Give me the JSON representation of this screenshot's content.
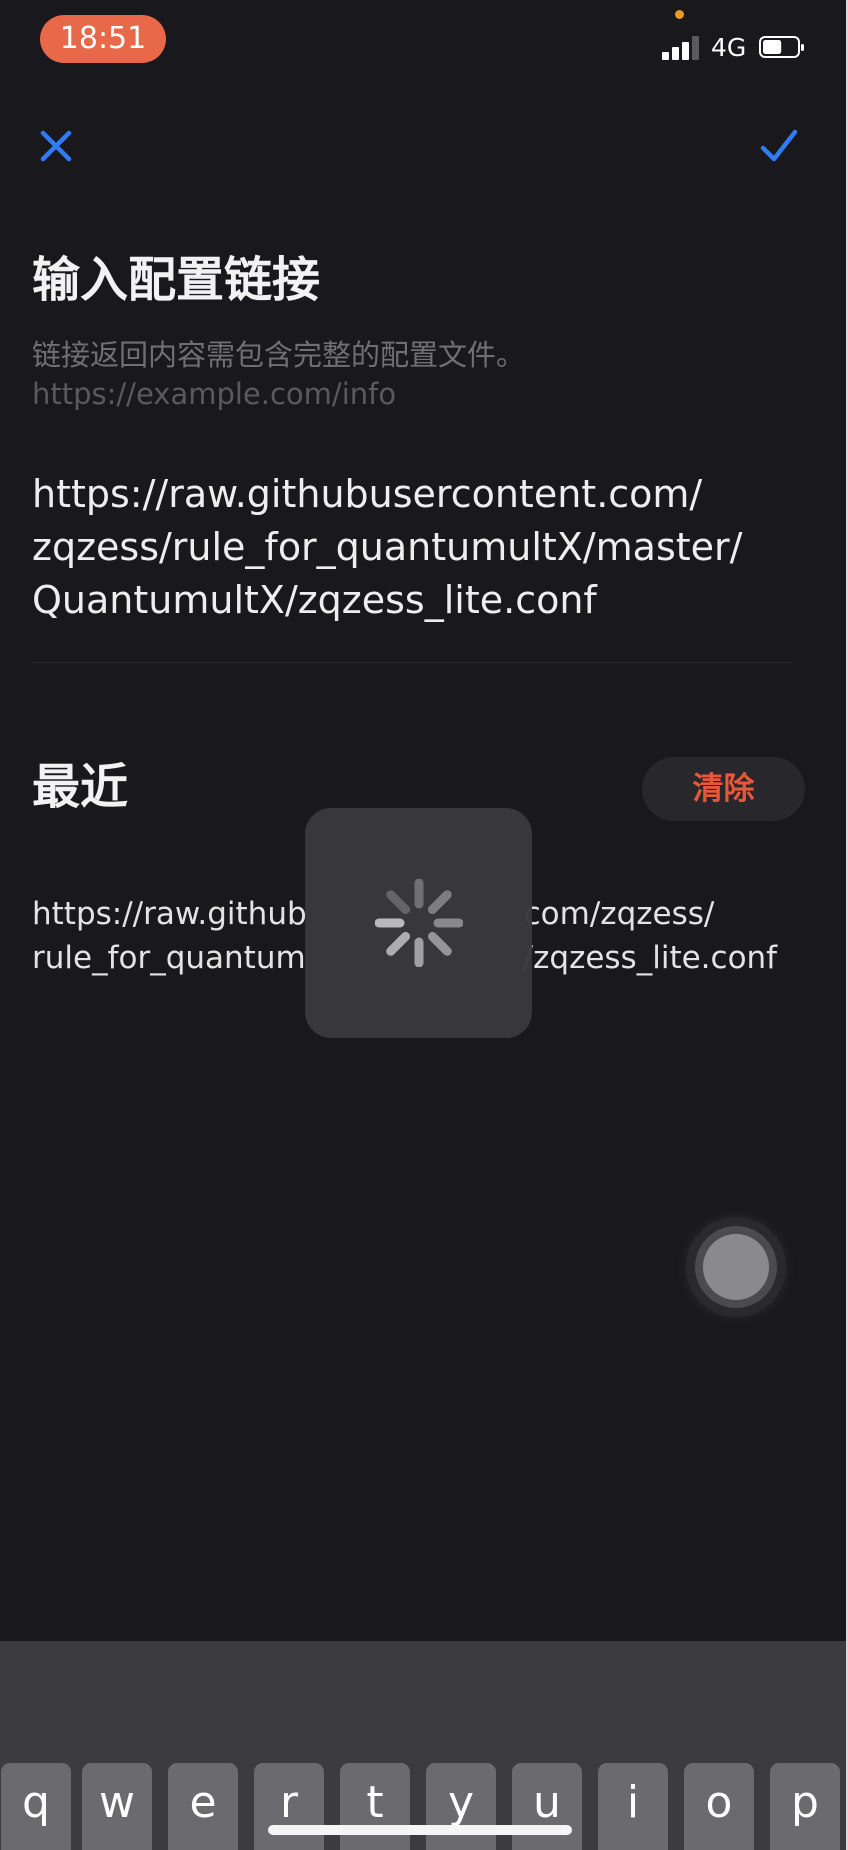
{
  "status_bar": {
    "time": "18:51",
    "network": "4G",
    "time_pill_color": "#e8684a",
    "privacy_dot_color": "#e89a2a",
    "signal_bars": 3,
    "signal_bars_total": 4,
    "battery_level": 0.55,
    "icons": [
      "signal-icon",
      "battery-icon"
    ]
  },
  "nav": {
    "close_icon": "close-icon",
    "confirm_icon": "checkmark-icon",
    "accent_color": "#2f7cf6"
  },
  "header": {
    "title": "输入配置链接",
    "subtitle": "链接返回内容需包含完整的配置文件。",
    "placeholder_example": "https://example.com/info"
  },
  "input": {
    "url": "https://raw.githubusercontent.com/\nzqzess/rule_for_quantumultX/master/\nQuantumultX/zqzess_lite.conf"
  },
  "recent": {
    "title": "最近",
    "clear_label": "清除",
    "clear_color": "#e7573a",
    "items": [
      "https://raw.github       com/zqzess/\nrule_for_quantum       /zqzess_lite.conf"
    ]
  },
  "overlay": {
    "loading_icon": "loading-spinner-icon"
  },
  "assistive_touch": {
    "icon": "assistive-touch-icon"
  },
  "keyboard": {
    "keys": [
      "q",
      "w",
      "e",
      "r",
      "t",
      "y",
      "u",
      "i",
      "o",
      "p"
    ]
  }
}
